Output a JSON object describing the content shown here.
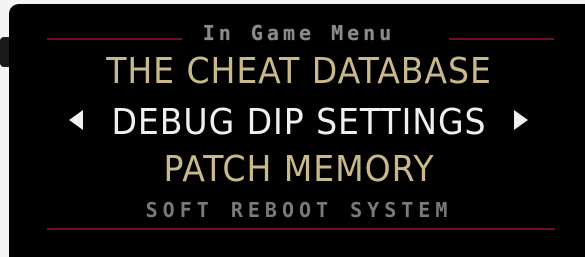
{
  "menu": {
    "title": "In Game Menu",
    "items": [
      {
        "label": "THE CHEAT DATABASE",
        "selected": false
      },
      {
        "label": "DEBUG DIP SETTINGS",
        "selected": true
      },
      {
        "label": "PATCH MEMORY",
        "selected": false
      },
      {
        "label": "SOFT REBOOT SYSTEM",
        "selected": false
      }
    ]
  },
  "colors": {
    "background": "#000000",
    "item_gold": "#c9b98a",
    "item_selected": "#f0f0f0",
    "item_dim": "#7a7a7a",
    "title_gray": "#8a8a8a",
    "rule_red": "#6e1024"
  },
  "icons": {
    "left": "triangle-left-icon",
    "right": "triangle-right-icon"
  }
}
